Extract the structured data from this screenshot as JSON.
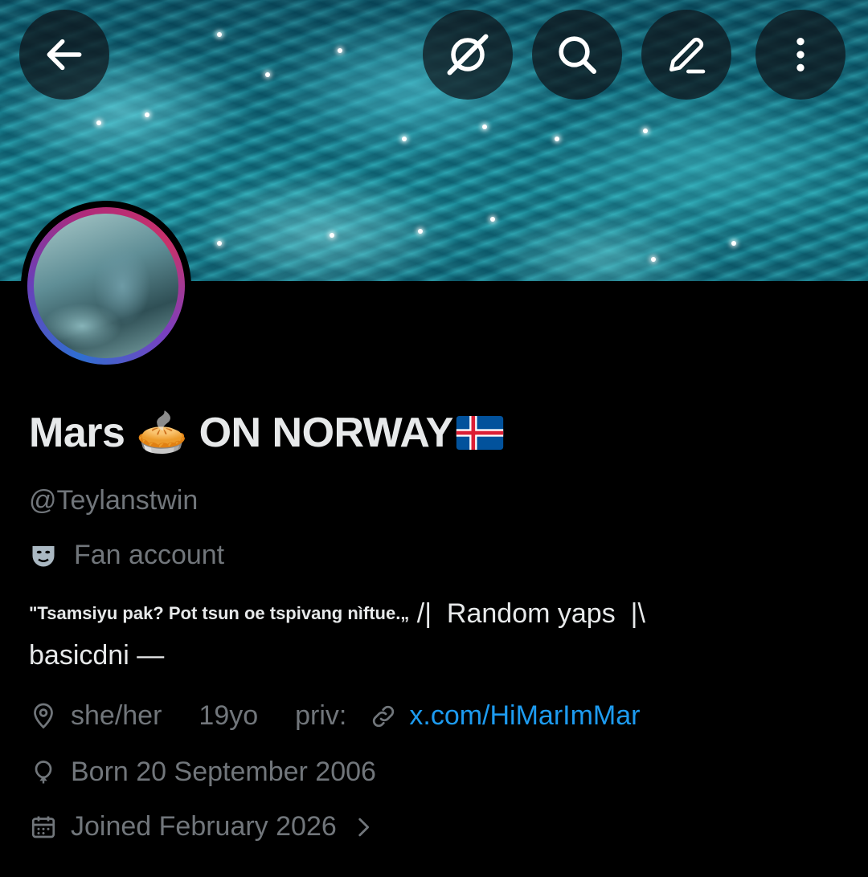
{
  "header": {
    "back_icon": "arrow-left-icon",
    "grok_icon": "grok-icon",
    "search_icon": "search-icon",
    "edit_icon": "pencil-icon",
    "more_icon": "more-vertical-icon"
  },
  "profile": {
    "display_name": "Mars",
    "display_name_emoji": "🥧",
    "display_name_suffix": "ON NORWAY",
    "flag_icon": "iceland-flag-icon",
    "handle": "@Teylanstwin",
    "category": "Fan account",
    "category_icon": "theater-masks-icon",
    "bio_quote": "\"Tsamsiyu pak? Pot tsun oe tspivang nìftue.„",
    "bio_line1_rest": "/|  Random yaps  |\\",
    "bio_line2": "basicdni —",
    "location": "she/her",
    "age": "19yo",
    "priv_label": "priv:",
    "url": "x.com/HiMarImMar",
    "birthday": "Born 20 September 2006",
    "joined": "Joined February 2026"
  },
  "colors": {
    "background": "#000000",
    "text_primary": "#e7e9ea",
    "text_secondary": "#71767b",
    "link": "#1d9bf0"
  }
}
